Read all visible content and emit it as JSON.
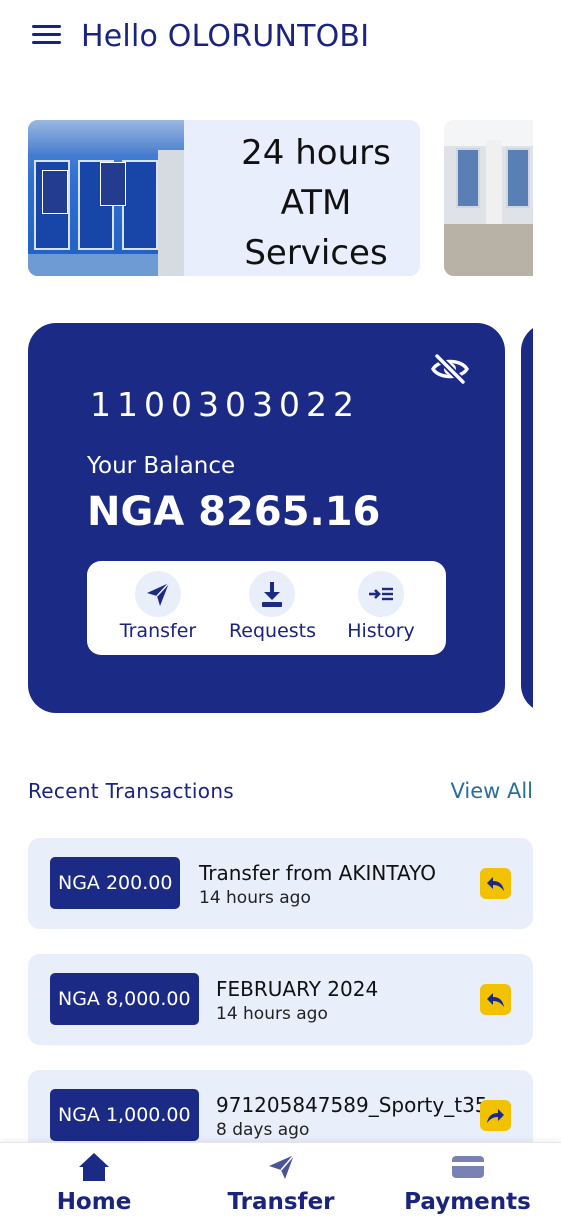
{
  "header": {
    "greeting": "Hello OLORUNTOBI",
    "menu_icon": "menu-icon"
  },
  "banners": [
    {
      "text_lines": [
        "24 hours",
        "ATM",
        "Services"
      ],
      "image": "atm-booth-photo"
    },
    {
      "image": "banking-hall-photo"
    }
  ],
  "account_card": {
    "account_number": "1100303022",
    "balance_label": "Your Balance",
    "balance": "NGA 8265.16",
    "visibility_icon": "eye-off-icon",
    "actions": [
      {
        "label": "Transfer",
        "icon": "send-icon"
      },
      {
        "label": "Requests",
        "icon": "download-icon"
      },
      {
        "label": "History",
        "icon": "history-icon"
      }
    ]
  },
  "recent": {
    "title": "Recent Transactions",
    "view_all": "View All",
    "transactions": [
      {
        "amount": "NGA 200.00",
        "title": "Transfer from AKINTAYO",
        "time": "14 hours ago",
        "direction": "incoming"
      },
      {
        "amount": "NGA 8,000.00",
        "title": "FEBRUARY 2024",
        "time": "14 hours ago",
        "direction": "incoming"
      },
      {
        "amount": "NGA 1,000.00",
        "title": "971205847589_Sporty_t35",
        "time": "8 days ago",
        "direction": "outgoing"
      }
    ]
  },
  "bottom_nav": [
    {
      "label": "Home",
      "icon": "home-icon"
    },
    {
      "label": "Transfer",
      "icon": "send-icon"
    },
    {
      "label": "Payments",
      "icon": "card-icon"
    }
  ],
  "colors": {
    "primary": "#1b2a85",
    "surface": "#e9eefb",
    "accent": "#f2c200",
    "link": "#2a6f9a"
  }
}
